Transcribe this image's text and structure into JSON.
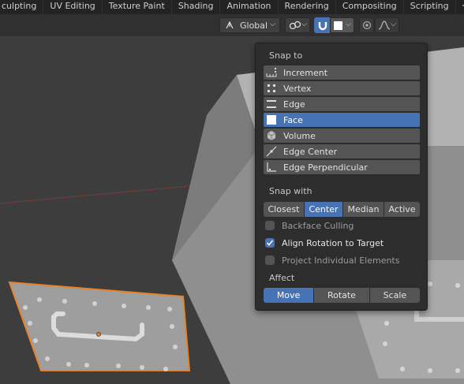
{
  "workspace_tabs": [
    "culpting",
    "UV Editing",
    "Texture Paint",
    "Shading",
    "Animation",
    "Rendering",
    "Compositing",
    "Scripting"
  ],
  "workspace_add": "+",
  "header": {
    "transform_orientation": "Global"
  },
  "popover": {
    "snap_to_label": "Snap to",
    "snap_to_items": [
      {
        "label": "Increment",
        "icon": "increment-icon",
        "active": false
      },
      {
        "label": "Vertex",
        "icon": "vertex-icon",
        "active": false
      },
      {
        "label": "Edge",
        "icon": "edge-icon",
        "active": false
      },
      {
        "label": "Face",
        "icon": "face-icon",
        "active": true
      },
      {
        "label": "Volume",
        "icon": "volume-icon",
        "active": false
      },
      {
        "label": "Edge Center",
        "icon": "edge-center-icon",
        "active": false
      },
      {
        "label": "Edge Perpendicular",
        "icon": "edge-perpendicular-icon",
        "active": false
      }
    ],
    "snap_with_label": "Snap with",
    "snap_with_options": [
      "Closest",
      "Center",
      "Median",
      "Active"
    ],
    "snap_with_selected": "Center",
    "options": [
      {
        "label": "Backface Culling",
        "checked": false
      },
      {
        "label": "Align Rotation to Target",
        "checked": true
      },
      {
        "label": "Project Individual Elements",
        "checked": false
      }
    ],
    "affect_label": "Affect",
    "affect_options": [
      "Move",
      "Rotate",
      "Scale"
    ],
    "affect_selected": "Move"
  },
  "colors": {
    "accent": "#4772b3",
    "selection_outline": "#e8822a",
    "x_axis_line": "#7a3a3a"
  }
}
